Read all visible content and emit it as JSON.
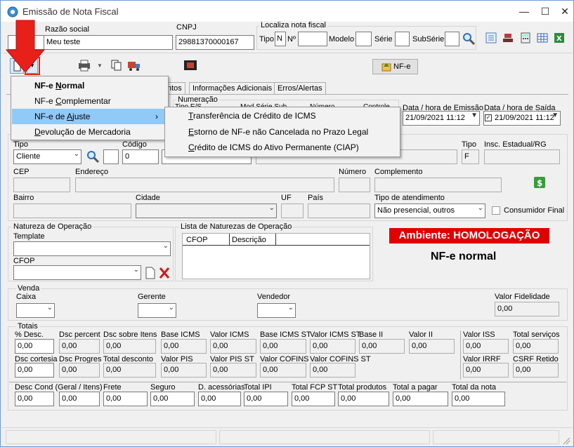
{
  "window": {
    "title": "Emissão de Nota Fiscal",
    "minimize_glyph": "—",
    "maximize_glyph": "☐",
    "close_glyph": "✕"
  },
  "header": {
    "razao_social_label": "Razão social",
    "razao_social_value": "Meu teste",
    "cnpj_label": "CNPJ",
    "cnpj_value": "29881370000167",
    "localiza_label": "Localiza nota fiscal",
    "tipo_label": "Tipo",
    "tipo_value": "N",
    "numero_label": "Nº",
    "modelo_label": "Modelo",
    "serie_label": "Série",
    "subserie_label": "SubSérie"
  },
  "toolbar": {
    "nfe_button_label": "NF-e"
  },
  "tabs": [
    "ntos",
    "Informações Adicionais",
    "Erros/Alertas"
  ],
  "numeracao": {
    "title": "Numeração",
    "tipo_es": "Tipo E/S",
    "mod_serie_sub": "Mod Série Sub",
    "numero": "Número",
    "controle": "Controle"
  },
  "datas": {
    "emissao_label": "Data / hora de Emissão",
    "emissao_value": "21/09/2021 11:12",
    "saida_label": "Data / hora de Saída",
    "saida_value": "21/09/2021 11:12"
  },
  "dropdown_menu": {
    "items": [
      {
        "pre": "NF-e ",
        "acc": "N",
        "post": "ormal"
      },
      {
        "pre": "NF-e ",
        "acc": "C",
        "post": "omplementar"
      },
      {
        "pre": "NF-e de ",
        "acc": "A",
        "post": "juste"
      },
      {
        "pre": "",
        "acc": "D",
        "post": "evolução de Mercadoria"
      }
    ],
    "submenu_arrow": "›"
  },
  "submenu": {
    "items": [
      {
        "acc": "T",
        "post": "ransferência de Crédito de ICMS"
      },
      {
        "acc": "E",
        "post": "storno de NF-e não Cancelada no Prazo Legal"
      },
      {
        "acc": "C",
        "post": "rédito de ICMS do Ativo Permanente (CIAP)"
      }
    ]
  },
  "destinatario": {
    "tipo_label": "Tipo",
    "tipo_value": "Cliente",
    "codigo_label": "Código",
    "codigo_value": "0",
    "tipo2_label": "Tipo",
    "tipo2_value": "F",
    "ie_label": "Insc. Estadual/RG",
    "cep_label": "CEP",
    "endereco_label": "Endereço",
    "numero_label": "Número",
    "complemento_label": "Complemento",
    "bairro_label": "Bairro",
    "cidade_label": "Cidade",
    "uf_label": "UF",
    "pais_label": "País",
    "atendimento_label": "Tipo de atendimento",
    "atendimento_value": "Não presencial, outros",
    "consumidor_final_label": "Consumidor Final"
  },
  "natureza": {
    "title": "Natureza de Operação",
    "template_label": "Template",
    "cfop_label": "CFOP",
    "lista_title": "Lista de Naturezas de Operação",
    "col_cfop": "CFOP",
    "col_descricao": "Descrição"
  },
  "ambiente_label": "Ambiente: HOMOLOGAÇÃO",
  "nfe_tipo_label": "NF-e normal",
  "venda": {
    "title": "Venda",
    "caixa_label": "Caixa",
    "gerente_label": "Gerente",
    "vendedor_label": "Vendedor",
    "valor_fidelidade_label": "Valor Fidelidade",
    "valor_fidelidade_value": "0,00"
  },
  "totais": {
    "title": "Totais",
    "row1": [
      {
        "label": "% Desc.",
        "value": "0,00"
      },
      {
        "label": "Dsc percent",
        "value": "0,00"
      },
      {
        "label": "Dsc sobre Itens",
        "value": "0,00"
      },
      {
        "label": "Base ICMS",
        "value": "0,00"
      },
      {
        "label": "Valor ICMS",
        "value": "0,00"
      },
      {
        "label": "Base ICMS ST",
        "value": "0,00"
      },
      {
        "label": "Valor ICMS ST",
        "value": "0,00"
      },
      {
        "label": "Base II",
        "value": "0,00"
      },
      {
        "label": "Valor II",
        "value": "0,00"
      },
      {
        "label": "Valor ISS",
        "value": "0,00"
      },
      {
        "label": "Total serviços",
        "value": "0,00"
      }
    ],
    "row2": [
      {
        "label": "Dsc cortesia",
        "value": "0,00"
      },
      {
        "label": "Dsc Progres",
        "value": "0,00"
      },
      {
        "label": "Total desconto",
        "value": "0,00"
      },
      {
        "label": "Valor PIS",
        "value": "0,00"
      },
      {
        "label": "Valor PIS ST",
        "value": "0,00"
      },
      {
        "label": "Valor COFINS",
        "value": "0,00"
      },
      {
        "label": "Valor COFINS ST",
        "value": "0,00"
      },
      {
        "label": "Valor IRRF",
        "value": "0,00"
      },
      {
        "label": "CSRF Retido",
        "value": "0,00"
      }
    ],
    "row3": [
      {
        "label": "Desc Cond (Geral / Itens)",
        "value": "0,00"
      },
      {
        "label": "",
        "value": "0,00"
      },
      {
        "label": "Frete",
        "value": "0,00"
      },
      {
        "label": "Seguro",
        "value": "0,00"
      },
      {
        "label": "D. acessórias",
        "value": "0,00"
      },
      {
        "label": "Total IPI",
        "value": "0,00"
      },
      {
        "label": "Total FCP ST",
        "value": "0,00"
      },
      {
        "label": "Total produtos",
        "value": "0,00"
      },
      {
        "label": "Total a pagar",
        "value": "0,00"
      },
      {
        "label": "Total da nota",
        "value": "0,00"
      }
    ]
  },
  "colors": {
    "ambiente_bg": "#e00000",
    "highlight": "#91c9f7",
    "arrow": "#e8201a"
  }
}
